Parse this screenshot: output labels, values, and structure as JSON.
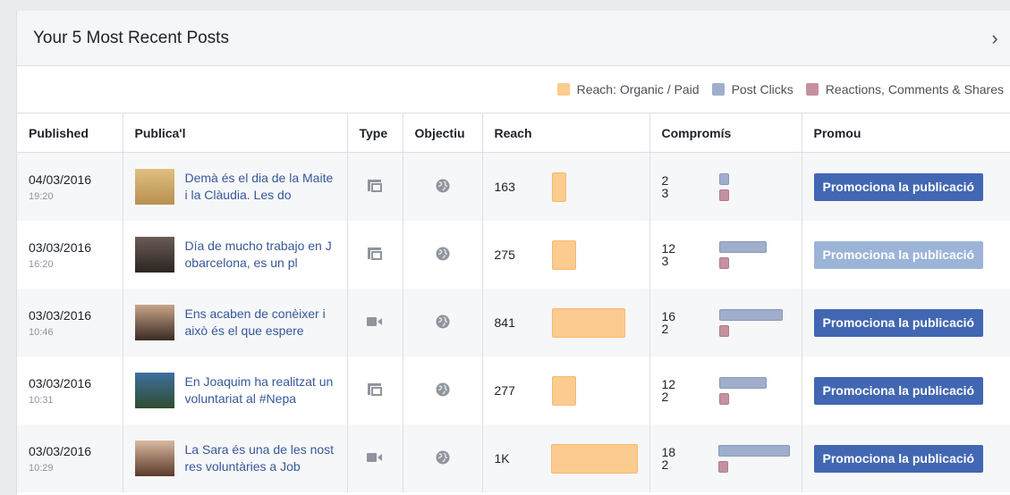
{
  "header": {
    "title": "Your 5 Most Recent Posts"
  },
  "legend": [
    {
      "label": "Reach: Organic / Paid",
      "color": "#fbcb8f"
    },
    {
      "label": "Post Clicks",
      "color": "#a0aecb"
    },
    {
      "label": "Reactions, Comments & Shares",
      "color": "#c6919f"
    }
  ],
  "columns": [
    "Published",
    "Publica'l",
    "Type",
    "Objectiu",
    "Reach",
    "Compromís",
    "Promou"
  ],
  "reach_max": 1000,
  "clicks_max": 18,
  "rows": [
    {
      "date": "04/03/2016",
      "time": "19:20",
      "text": "Demà és el dia de la Maite i la Clàudia. Les do",
      "type": "multi-photo-icon",
      "reach_label": "163",
      "reach_value": 163,
      "clicks": "2",
      "clicks_value": 2,
      "reactions": "3",
      "reactions_value": 3,
      "promote": "Promociona la publicació",
      "promote_enabled": true,
      "thumb": [
        "#e0c080",
        "#b89050"
      ]
    },
    {
      "date": "03/03/2016",
      "time": "16:20",
      "text": "Día de mucho trabajo en Jobarcelona, es un pl",
      "type": "multi-photo-icon",
      "reach_label": "275",
      "reach_value": 275,
      "clicks": "12",
      "clicks_value": 12,
      "reactions": "3",
      "reactions_value": 3,
      "promote": "Promociona la publicació",
      "promote_enabled": false,
      "thumb": [
        "#6a5c55",
        "#2c2522"
      ]
    },
    {
      "date": "03/03/2016",
      "time": "10:46",
      "text": "Ens acaben de conèixer i això és el que espere",
      "type": "video-icon",
      "reach_label": "841",
      "reach_value": 841,
      "clicks": "16",
      "clicks_value": 16,
      "reactions": "2",
      "reactions_value": 2,
      "promote": "Promociona la publicació",
      "promote_enabled": true,
      "thumb": [
        "#c9a58a",
        "#3a2a22"
      ]
    },
    {
      "date": "03/03/2016",
      "time": "10:31",
      "text": "En Joaquim ha realitzat un voluntariat al #Nepa",
      "type": "multi-photo-icon",
      "reach_label": "277",
      "reach_value": 277,
      "clicks": "12",
      "clicks_value": 12,
      "reactions": "2",
      "reactions_value": 2,
      "promote": "Promociona la publicació",
      "promote_enabled": true,
      "thumb": [
        "#3f6fa0",
        "#2f4d2f"
      ]
    },
    {
      "date": "03/03/2016",
      "time": "10:29",
      "text": "La Sara és una de les nostres voluntàries a Job",
      "type": "video-icon",
      "reach_label": "1K",
      "reach_value": 1000,
      "clicks": "18",
      "clicks_value": 18,
      "reactions": "2",
      "reactions_value": 2,
      "promote": "Promociona la publicació",
      "promote_enabled": true,
      "thumb": [
        "#d8b9a0",
        "#5a3a2a"
      ]
    }
  ]
}
